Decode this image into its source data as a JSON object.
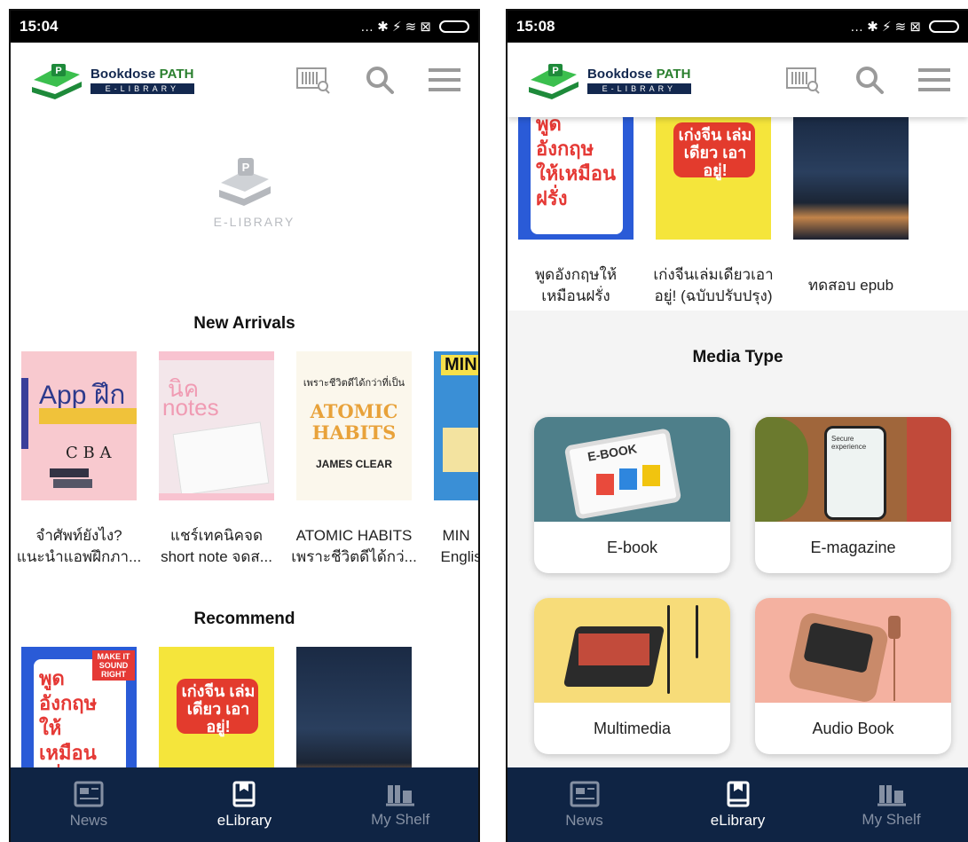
{
  "left": {
    "status": {
      "time": "15:04",
      "icons": "… ✱ ⚡ ≋ ⊠"
    },
    "brand": {
      "name_a": "Bookdose ",
      "name_b": "PATH",
      "sub": "E-LIBRARY"
    },
    "hero_label": "E-LIBRARY",
    "new_arrivals": {
      "title": "New Arrivals",
      "books": [
        {
          "line1": "จำศัพท์ยังไง?",
          "line2": "แนะนำแอพฝึกภา...",
          "cover_text": "App ฝึก"
        },
        {
          "line1": "แชร์เทคนิคจด",
          "line2": "short note จดส...",
          "cover_text": "notes"
        },
        {
          "line1": "ATOMIC HABITS",
          "line2": "เพราะชีวิตดีได้กว่...",
          "cover_text": "ATOMIC HABITS",
          "cover_sub": "JAMES CLEAR",
          "cover_top": "เพราะชีวิตดีได้กว่าที่เป็น"
        },
        {
          "line1": "MIN",
          "line2": "Englis",
          "cover_text": "MINI"
        }
      ]
    },
    "recommend": {
      "title": "Recommend",
      "books": [
        {
          "cover_text": "พูด อังกฤษ ให้เหมือน ฝรั่ง",
          "badge": "MAKE IT SOUND RIGHT"
        },
        {
          "cover_text": "เก่งจีน เล่มเดียว เอาอยู่!"
        },
        {
          "cover_text": ""
        }
      ]
    },
    "nav": [
      {
        "label": "News",
        "icon": "newspaper-icon"
      },
      {
        "label": "eLibrary",
        "icon": "bookmark-book-icon",
        "active": true
      },
      {
        "label": "My Shelf",
        "icon": "shelf-icon"
      }
    ]
  },
  "right": {
    "status": {
      "time": "15:08",
      "icons": "… ✱ ⚡ ≋ ⊠"
    },
    "brand": {
      "name_a": "Bookdose ",
      "name_b": "PATH",
      "sub": "E-LIBRARY"
    },
    "books": [
      {
        "line1": "พูดอังกฤษให้",
        "line2": "เหมือนฝรั่ง",
        "cover_text": "พูด อังกฤษ ให้เหมือน ฝรั่ง"
      },
      {
        "line1": "เก่งจีนเล่มเดียวเอา",
        "line2": "อยู่! (ฉบับปรับปรุง)",
        "cover_text": "เก่งจีน เล่มเดียว เอาอยู่!"
      },
      {
        "line1": "ทดสอบ epub",
        "line2": "",
        "cover_text": ""
      }
    ],
    "media_title": "Media Type",
    "media": [
      {
        "label": "E-book",
        "img_text": "E-BOOK"
      },
      {
        "label": "E-magazine",
        "img_text": "Secure experience"
      },
      {
        "label": "Multimedia",
        "img_text": ""
      },
      {
        "label": "Audio Book",
        "img_text": ""
      }
    ],
    "nav": [
      {
        "label": "News",
        "icon": "newspaper-icon"
      },
      {
        "label": "eLibrary",
        "icon": "bookmark-book-icon",
        "active": true
      },
      {
        "label": "My Shelf",
        "icon": "shelf-icon"
      }
    ]
  },
  "colors": {
    "navy": "#0f2444",
    "brand_green": "#2a7f2e",
    "brand_navy": "#13284f"
  }
}
